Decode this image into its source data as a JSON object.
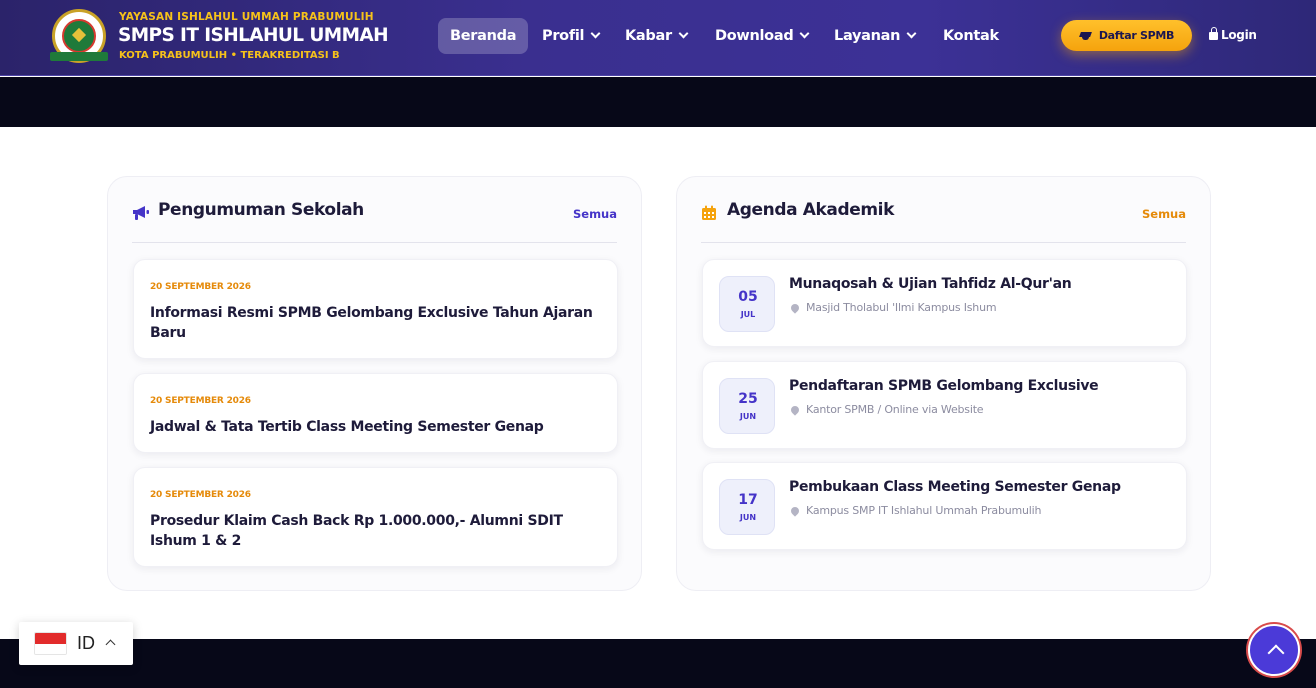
{
  "header": {
    "org_name": "YAYASAN ISHLAHUL UMMAH PRABUMULIH",
    "school_name": "SMPS IT ISHLAHUL UMMAH",
    "tagline": "KOTA PRABUMULIH • TERAKREDITASI B",
    "logo_text": "ISHLAHUL UMMAH"
  },
  "nav": {
    "items": [
      {
        "label": "Beranda",
        "active": true
      },
      {
        "label": "Profil",
        "dropdown": true
      },
      {
        "label": "Kabar",
        "dropdown": true
      },
      {
        "label": "Download",
        "dropdown": true
      },
      {
        "label": "Layanan",
        "dropdown": true
      },
      {
        "label": "Kontak"
      }
    ],
    "cta_label": "Daftar SPMB",
    "cta_icon": "graduation-cap-icon",
    "login_label": "Login",
    "login_icon": "lock-icon"
  },
  "announcements": {
    "title": "Pengumuman Sekolah",
    "icon": "megaphone-icon",
    "link": "Semua",
    "items": [
      {
        "date": "20 SEPTEMBER 2026",
        "title": "Informasi Resmi SPMB Gelombang Exclusive Tahun Ajaran Baru"
      },
      {
        "date": "20 SEPTEMBER 2026",
        "title": "Jadwal & Tata Tertib Class Meeting Semester Genap"
      },
      {
        "date": "20 SEPTEMBER 2026",
        "title": "Prosedur Klaim Cash Back Rp 1.000.000,- Alumni SDIT Ishum 1 & 2"
      }
    ]
  },
  "agenda": {
    "title": "Agenda Akademik",
    "icon": "calendar-icon",
    "link": "Semua",
    "items": [
      {
        "day": "05",
        "month": "JUL",
        "title": "Munaqosah & Ujian Tahfidz Al-Qur'an",
        "location": "Masjid Tholabul 'Ilmi Kampus Ishum"
      },
      {
        "day": "25",
        "month": "JUN",
        "title": "Pendaftaran SPMB Gelombang Exclusive",
        "location": "Kantor SPMB / Online via Website"
      },
      {
        "day": "17",
        "month": "JUN",
        "title": "Pembukaan Class Meeting Semester Genap",
        "location": "Kampus SMP IT Ishlahul Ummah Prabumulih"
      }
    ]
  },
  "language": {
    "code": "ID"
  },
  "colors": {
    "primary": "#4534c8",
    "accent": "#f5a30d",
    "header_bg": "#2b236a",
    "dark_band": "#070818"
  }
}
